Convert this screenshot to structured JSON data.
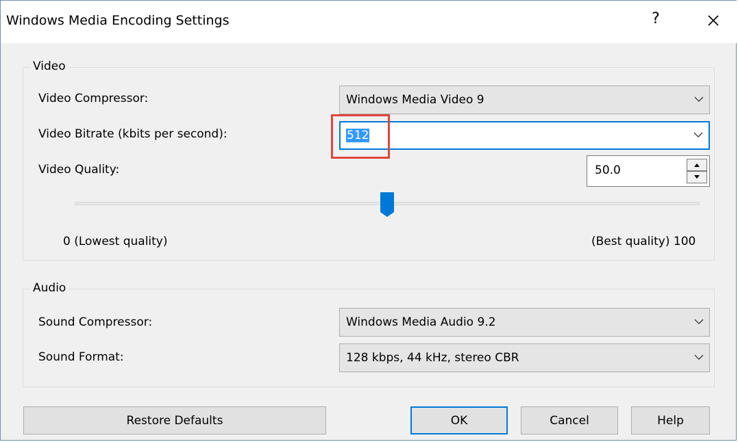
{
  "window": {
    "title": "Windows Media Encoding Settings",
    "help_glyph": "?",
    "close_icon": "close-icon"
  },
  "video": {
    "group_label": "Video",
    "compressor_label": "Video Compressor:",
    "compressor_value": "Windows Media Video 9",
    "bitrate_label": "Video Bitrate (kbits per second):",
    "bitrate_value": "512",
    "quality_label": "Video Quality:",
    "quality_value": "50.0",
    "quality_level": 50,
    "quality_min_label": "0 (Lowest quality)",
    "quality_max_label": "(Best quality) 100"
  },
  "audio": {
    "group_label": "Audio",
    "compressor_label": "Sound Compressor:",
    "compressor_value": "Windows Media Audio 9.2",
    "format_label": "Sound Format:",
    "format_value": "128 kbps, 44 kHz, stereo CBR"
  },
  "buttons": {
    "restore": "Restore Defaults",
    "ok": "OK",
    "cancel": "Cancel",
    "help": "Help"
  },
  "colors": {
    "accent": "#0078d7",
    "selection": "#3399ff",
    "highlight_box": "#e0443e"
  }
}
